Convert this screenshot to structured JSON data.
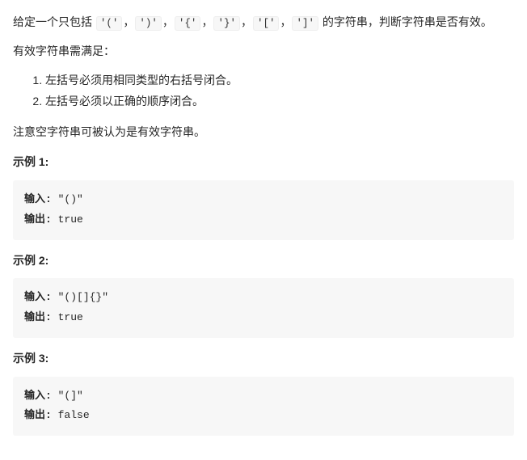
{
  "intro": {
    "pre": "给定一个只包括 ",
    "chars": [
      "'('",
      "')'",
      "'{'",
      "'}'",
      "'['",
      "']'"
    ],
    "sep": "，",
    "post": " 的字符串，判断字符串是否有效。"
  },
  "valid_req": "有效字符串需满足：",
  "rules": [
    "左括号必须用相同类型的右括号闭合。",
    "左括号必须以正确的顺序闭合。"
  ],
  "note": "注意空字符串可被认为是有效字符串。",
  "io_labels": {
    "input": "输入:",
    "output": "输出:"
  },
  "examples": [
    {
      "label": "示例 1:",
      "input": "\"()\"",
      "output": "true"
    },
    {
      "label": "示例 2:",
      "input": "\"()[]{}\"",
      "output": "true"
    },
    {
      "label": "示例 3:",
      "input": "\"(]\"",
      "output": "false"
    }
  ]
}
